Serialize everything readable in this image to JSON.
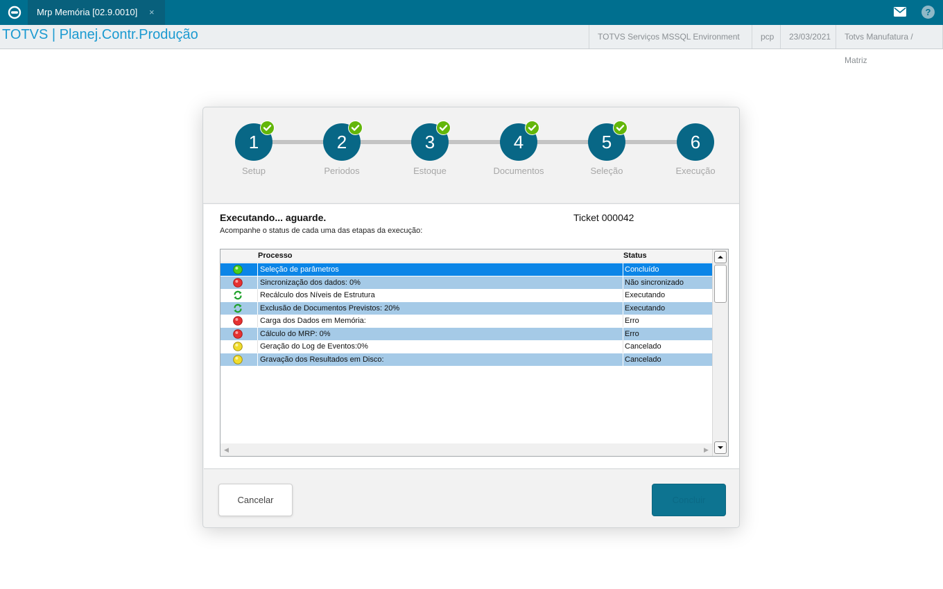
{
  "tab": {
    "title": "Mrp Memória [02.9.0010]",
    "close": "×"
  },
  "header": {
    "app_title": "TOTVS | Planej.Contr.Produção",
    "environment": "TOTVS Serviços MSSQL Environment",
    "user": "pcp",
    "date": "23/03/2021",
    "company": "Totvs Manufatura / Matriz"
  },
  "steps": [
    {
      "number": "1",
      "label": "Setup",
      "done": true
    },
    {
      "number": "2",
      "label": "Periodos",
      "done": true
    },
    {
      "number": "3",
      "label": "Estoque",
      "done": true
    },
    {
      "number": "4",
      "label": "Documentos",
      "done": true
    },
    {
      "number": "5",
      "label": "Seleção",
      "done": true
    },
    {
      "number": "6",
      "label": "Execução",
      "done": false
    }
  ],
  "execution": {
    "title": "Executando... aguarde.",
    "ticket": "Ticket 000042",
    "subtitle": "Acompanhe o status de cada uma das etapas da execução:"
  },
  "grid": {
    "headers": {
      "process": "Processo",
      "status": "Status"
    },
    "rows": [
      {
        "icon": "green-light-icon",
        "process": "Seleção de parâmetros",
        "status": "Concluído"
      },
      {
        "icon": "red-light-icon",
        "process": "Sincronização dos dados: 0%",
        "status": "Não sincronizado"
      },
      {
        "icon": "refresh-icon",
        "process": "Recálculo dos Níveis de Estrutura",
        "status": "Executando"
      },
      {
        "icon": "refresh-icon",
        "process": "Exclusão de Documentos Previstos: 20%",
        "status": "Executando"
      },
      {
        "icon": "red-light-icon",
        "process": "Carga dos Dados em Memória:",
        "status": "Erro"
      },
      {
        "icon": "red-light-icon",
        "process": "Cálculo do MRP: 0%",
        "status": "Erro"
      },
      {
        "icon": "yellow-light-icon",
        "process": "Geração do Log de Eventos:0%",
        "status": "Cancelado"
      },
      {
        "icon": "yellow-light-icon",
        "process": "Gravação dos Resultados em Disco:",
        "status": "Cancelado"
      }
    ]
  },
  "buttons": {
    "cancel": "Cancelar",
    "conclude": "Concluir"
  },
  "colors": {
    "brand": "#006f8f",
    "step": "#086786",
    "check": "#63b60a",
    "row_selected": "#0b85e7",
    "row_alt": "#a5cae7"
  }
}
